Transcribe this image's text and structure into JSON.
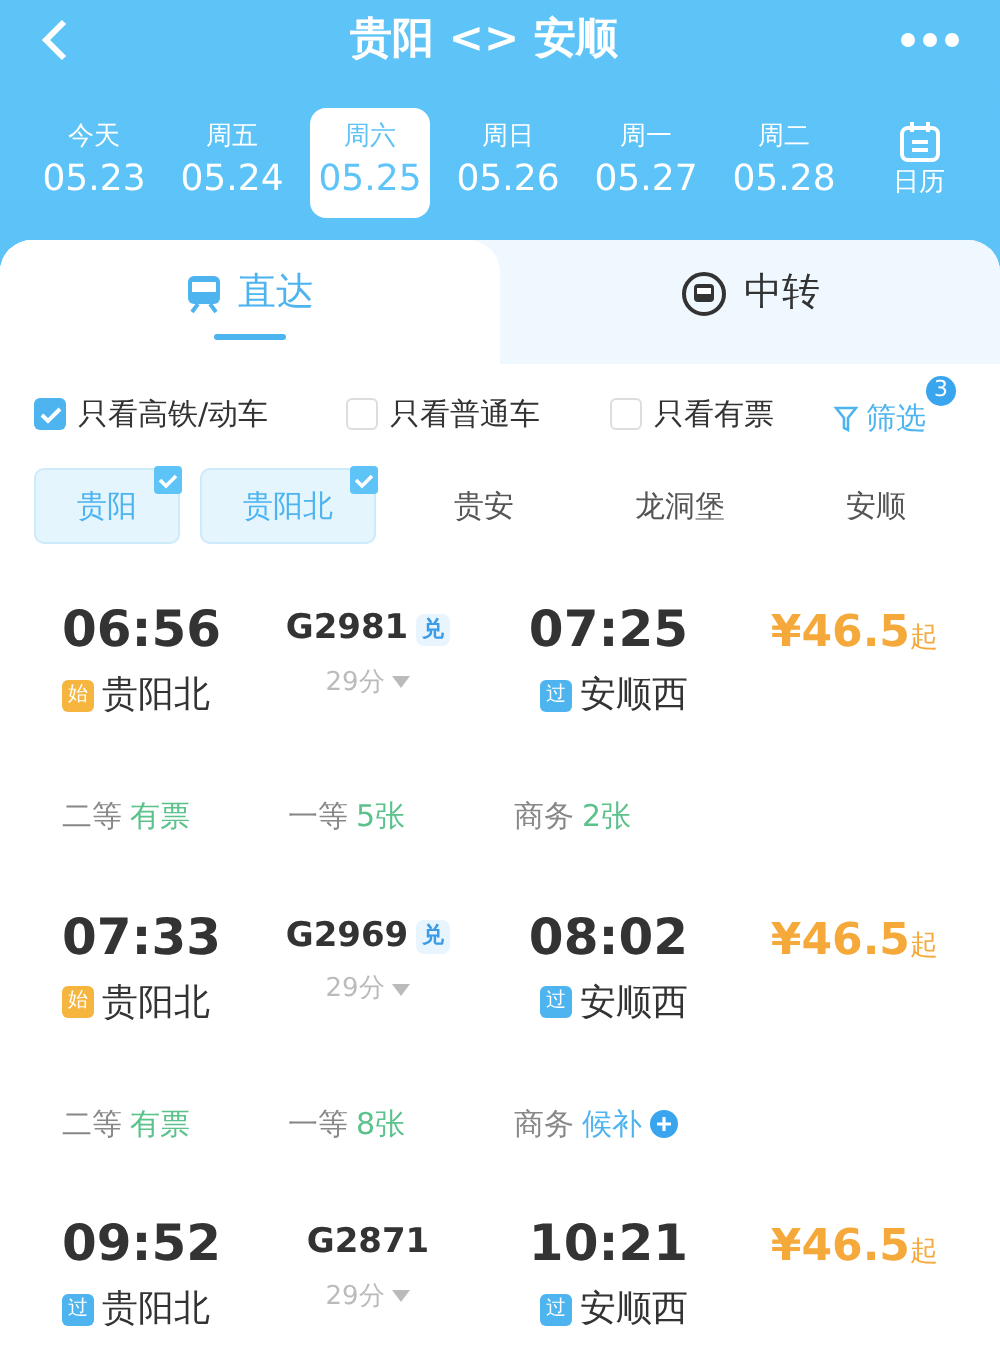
{
  "header": {
    "title": "贵阳 <> 安顺"
  },
  "dates": [
    {
      "weekday": "今天",
      "date": "05.23",
      "selected": false
    },
    {
      "weekday": "周五",
      "date": "05.24",
      "selected": false
    },
    {
      "weekday": "周六",
      "date": "05.25",
      "selected": true
    },
    {
      "weekday": "周日",
      "date": "05.26",
      "selected": false
    },
    {
      "weekday": "周一",
      "date": "05.27",
      "selected": false
    },
    {
      "weekday": "周二",
      "date": "05.28",
      "selected": false
    }
  ],
  "calendar_label": "日历",
  "tabs": [
    {
      "label": "直达",
      "selected": true
    },
    {
      "label": "中转",
      "selected": false
    }
  ],
  "filters": [
    {
      "label": "只看高铁/动车",
      "checked": true
    },
    {
      "label": "只看普通车",
      "checked": false
    },
    {
      "label": "只看有票",
      "checked": false
    }
  ],
  "filter_button": {
    "label": "筛选",
    "badge": "3"
  },
  "stations": [
    {
      "name": "贵阳",
      "selected": true
    },
    {
      "name": "贵阳北",
      "selected": true
    },
    {
      "name": "贵安",
      "selected": false
    },
    {
      "name": "龙洞堡",
      "selected": false
    },
    {
      "name": "安顺",
      "selected": false
    }
  ],
  "trains": [
    {
      "depart": "06:56",
      "number": "G2981",
      "exchange": "兑",
      "duration": "29分",
      "arrive": "07:25",
      "price": "¥46.5",
      "price_suffix": "起",
      "from": {
        "badge": "始",
        "kind": "start",
        "name": "贵阳北"
      },
      "to": {
        "badge": "过",
        "kind": "pass",
        "name": "安顺西"
      },
      "seats": [
        {
          "class": "二等",
          "status": "有票",
          "kind": "available"
        },
        {
          "class": "一等",
          "status": "5张",
          "kind": "available"
        },
        {
          "class": "商务",
          "status": "2张",
          "kind": "available"
        }
      ]
    },
    {
      "depart": "07:33",
      "number": "G2969",
      "exchange": "兑",
      "duration": "29分",
      "arrive": "08:02",
      "price": "¥46.5",
      "price_suffix": "起",
      "from": {
        "badge": "始",
        "kind": "start",
        "name": "贵阳北"
      },
      "to": {
        "badge": "过",
        "kind": "pass",
        "name": "安顺西"
      },
      "seats": [
        {
          "class": "二等",
          "status": "有票",
          "kind": "available"
        },
        {
          "class": "一等",
          "status": "8张",
          "kind": "available"
        },
        {
          "class": "商务",
          "status": "候补",
          "kind": "waitlist"
        }
      ]
    },
    {
      "depart": "09:52",
      "number": "G2871",
      "duration": "29分",
      "arrive": "10:21",
      "price": "¥46.5",
      "price_suffix": "起",
      "from": {
        "badge": "过",
        "kind": "pass",
        "name": "贵阳北"
      },
      "to": {
        "badge": "过",
        "kind": "pass",
        "name": "安顺西"
      }
    }
  ]
}
